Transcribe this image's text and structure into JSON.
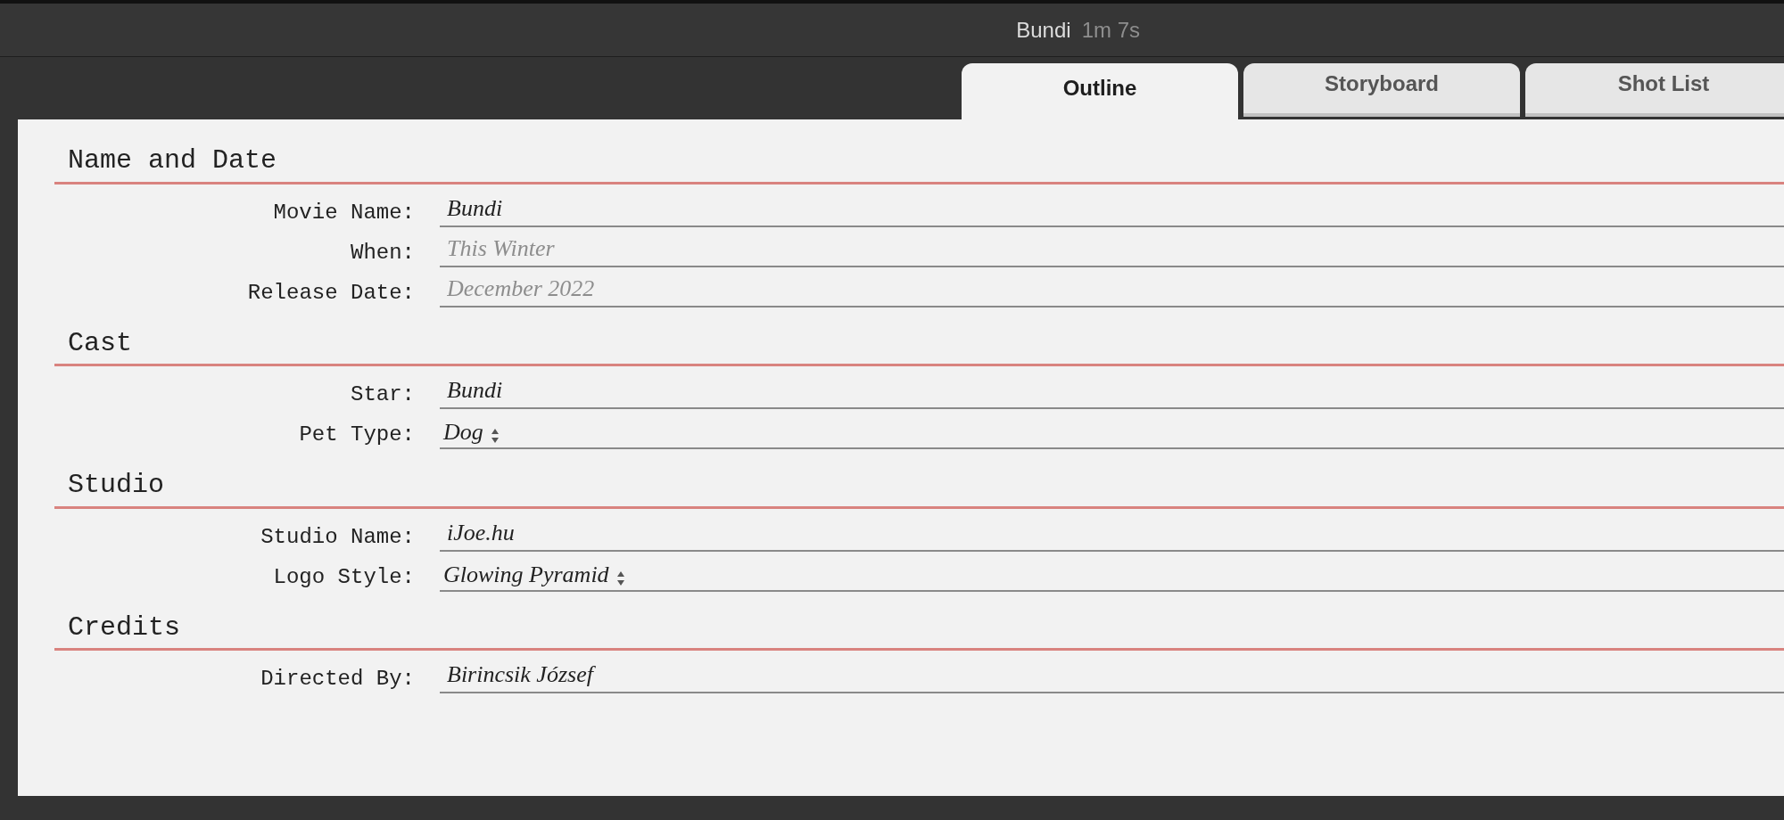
{
  "window": {
    "title": "Bundi",
    "duration": "1m 7s"
  },
  "tabs": [
    {
      "label": "Outline",
      "selected": true
    },
    {
      "label": "Storyboard",
      "selected": false
    },
    {
      "label": "Shot List",
      "selected": false
    }
  ],
  "sections": [
    {
      "title": "Name and Date",
      "fields": [
        {
          "kind": "text",
          "label": "Movie Name:",
          "value": "Bundi"
        },
        {
          "kind": "text",
          "label": "When:",
          "placeholder": "This Winter"
        },
        {
          "kind": "text",
          "label": "Release Date:",
          "placeholder": "December 2022"
        }
      ]
    },
    {
      "title": "Cast",
      "fields": [
        {
          "kind": "text",
          "label": "Star:",
          "value": "Bundi"
        },
        {
          "kind": "popup",
          "label": "Pet Type:",
          "value": "Dog"
        }
      ]
    },
    {
      "title": "Studio",
      "fields": [
        {
          "kind": "text",
          "label": "Studio Name:",
          "value": "iJoe.hu"
        },
        {
          "kind": "popup",
          "label": "Logo Style:",
          "value": "Glowing Pyramid"
        }
      ]
    },
    {
      "title": "Credits",
      "fields": [
        {
          "kind": "text",
          "label": "Directed By:",
          "value": "Birincsik József"
        }
      ]
    }
  ]
}
